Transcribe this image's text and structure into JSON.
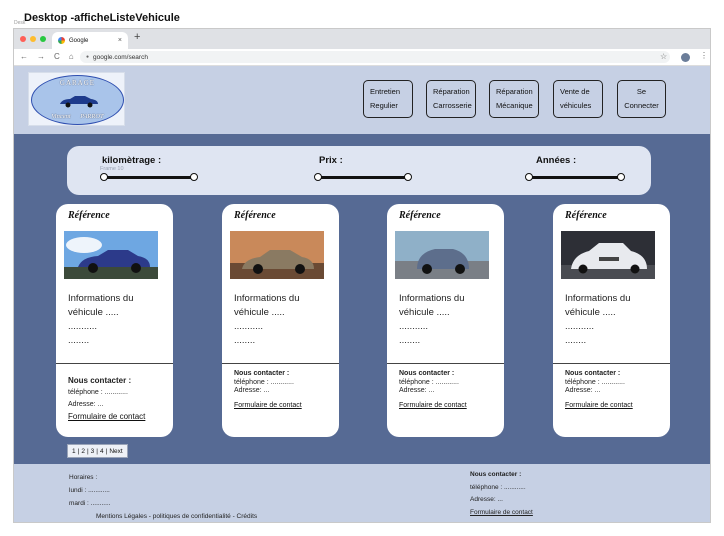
{
  "frame": {
    "title": "Desktop -afficheListeVehicule",
    "subtitle": "Desk"
  },
  "browser": {
    "tab_title": "Google",
    "tab_close": "×",
    "new_tab": "+",
    "url": "google.com/search",
    "nav": {
      "back": "←",
      "forward": "→",
      "reload": "C",
      "home": "⌂"
    },
    "star": "☆",
    "menu": "⋮"
  },
  "logo": {
    "line1": "GARAGE",
    "line2": "Vincent PARROT"
  },
  "nav": [
    {
      "label": "Entretien\nRegulier"
    },
    {
      "label": "Réparation\nCarrosserie"
    },
    {
      "label": "Réparation\nMécanique"
    },
    {
      "label": "Vente de\nvéhicules"
    },
    {
      "label": "Se\nConnecter"
    }
  ],
  "filters": {
    "km_label": "kilomètrage :",
    "km_hint": "Frame 10",
    "price_label": "Prix :",
    "year_label": "Années :"
  },
  "cards": [
    {
      "ref": "Référence",
      "info": "Informations du\nvéhicule .....\n...........\n........",
      "contact_title": "Nous contacter :",
      "phone": "téléphone  : ............",
      "address": "Adresse: ...",
      "link": "Formulaire de contact",
      "car_color": "#2c3a8a",
      "sky": "#6ea7e2"
    },
    {
      "ref": "Référence",
      "info": "Informations du\nvéhicule .....\n...........\n........",
      "contact_title": "Nous contacter :",
      "phone": "téléphone  : ............",
      "address": "Adresse: ...",
      "link": "Formulaire de contact",
      "car_color": "#8a7a62",
      "sky": "#c9895a"
    },
    {
      "ref": "Référence",
      "info": "Informations du\nvéhicule .....\n...........\n........",
      "contact_title": "Nous contacter :",
      "phone": "téléphone  : ............",
      "address": "Adresse: ...",
      "link": "Formulaire de contact",
      "car_color": "#5d6e8c",
      "sky": "#8fb0c8"
    },
    {
      "ref": "Référence",
      "info": "Informations du\nvéhicule .....\n...........\n........",
      "contact_title": "Nous contacter :",
      "phone": "téléphone  : ............",
      "address": "Adresse: ...",
      "link": "Formulaire de contact",
      "car_color": "#e8eaee",
      "sky": "#2d2f36"
    }
  ],
  "pager": {
    "p1": "1",
    "p2": "2",
    "p3": "3",
    "p4": "4",
    "next": "Next",
    "sep": "|"
  },
  "footer": {
    "hours": "Horaires :",
    "monday": "lundi : ............",
    "tuesday": "mardi : ...........",
    "legal": "Mentions Légales - politiques de confidentialité - Crédits",
    "contact_title": "Nous contacter :",
    "phone": "téléphone  : ............",
    "address": "Adresse: ...",
    "link": "Formulaire de contact"
  },
  "colors": {
    "page_bg": "#566a94",
    "header_bg": "#c6d0e4",
    "filter_bg": "#dfe5f2"
  }
}
